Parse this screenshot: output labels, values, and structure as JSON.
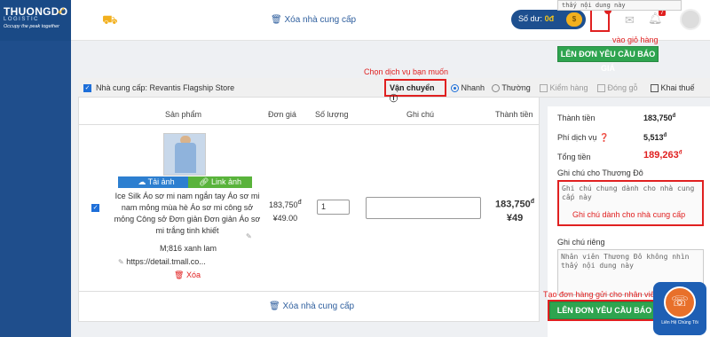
{
  "brand": {
    "name": "THUONGDO",
    "sub": "LOGISTIC",
    "tagline": "Occupy the peak together"
  },
  "topbar": {
    "remove_supplier": "Xóa nhà cung cấp",
    "balance_label": "Số dư:",
    "balance_value": "0đ",
    "bell_count": "7",
    "tooltip_text": "thấy nội dung này",
    "cart_note": "vào giỏ hàng"
  },
  "quote_button": "LÊN ĐƠN YÊU CẦU BÁO GIÁ",
  "annotations": {
    "choose_service": "Chọn dịch vụ bạn muốn",
    "create_order_staff": "Tạo đơn hàng gửi cho nhân viên",
    "supplier_note": "Ghi chú dành cho nhà cung cấp"
  },
  "supplier": {
    "name": "Nhà cung cấp: Revantis Flagship Store",
    "shipping_label": "Vận chuyển",
    "options": [
      {
        "label": "Nhanh",
        "selected": true
      },
      {
        "label": "Thường",
        "selected": false
      }
    ],
    "extras": [
      "Kiểm hàng",
      "Đóng gỗ",
      "Khai thuế"
    ]
  },
  "table": {
    "headers": [
      "Sản phẩm",
      "Đơn giá",
      "Số lượng",
      "Ghi chú",
      "Thành tiền"
    ],
    "item": {
      "upload_label": "Tải ảnh",
      "link_label": "Link ảnh",
      "name": "Ice Silk Áo sơ mi nam ngắn tay Áo sơ mi nam mỏng mùa hè Áo sơ mi công sở mỏng Công sở Đơn giản Đơn giản Áo sơ mi trắng tinh khiết",
      "attr": "M;816 xanh lam",
      "url": "https://detail.tmall.co...",
      "delete": "Xóa",
      "price_vnd": "183,750",
      "price_cny": "¥49.00",
      "qty": "1",
      "total_vnd": "183,750",
      "total_cny": "¥49",
      "currency": "đ"
    }
  },
  "summary": {
    "subtotal_label": "Thành tiền",
    "subtotal_value": "183,750",
    "fee_label": "Phí dịch vụ",
    "fee_value": "5,513",
    "total_label": "Tổng tiền",
    "total_value": "189,263",
    "note_thuongdo_label": "Ghi chú cho Thương Đô",
    "note_thuongdo_text": "Ghi chú chung dành cho nhà cung cấp này",
    "private_note_label": "Ghi chú riêng",
    "private_note_text": "Nhân viên Thương Đô không nhìn thấy nội dung này"
  },
  "support_label": "Liên Hệ Chúng Tôi"
}
